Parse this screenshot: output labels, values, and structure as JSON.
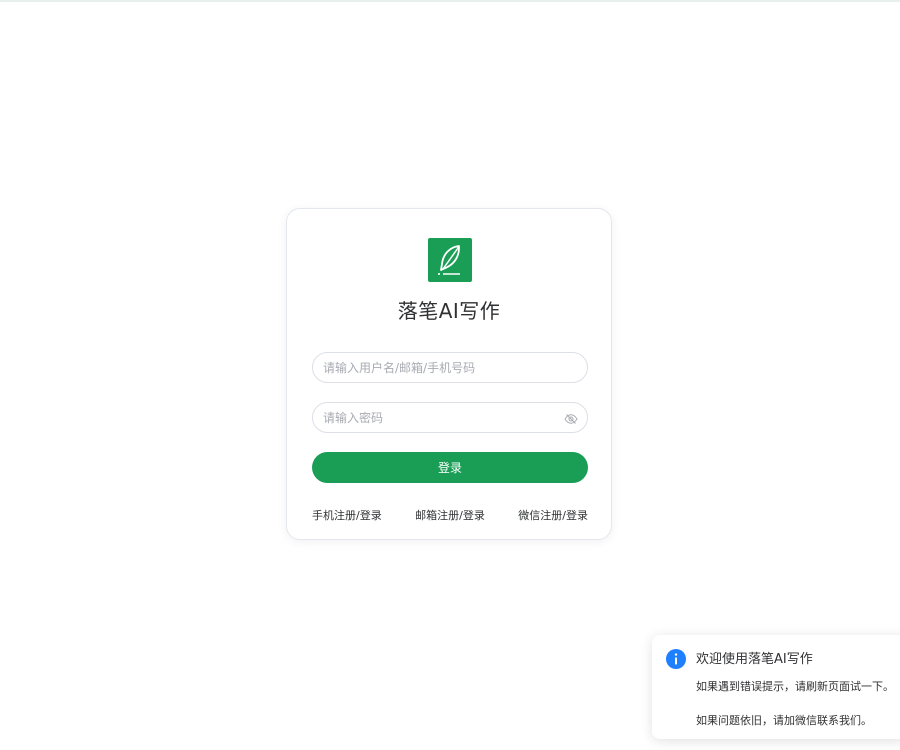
{
  "app": {
    "title": "落笔AI写作",
    "brand_color": "#1a9d55"
  },
  "login_form": {
    "username_placeholder": "请输入用户名/邮箱/手机号码",
    "password_placeholder": "请输入密码",
    "password_toggle_icon": "eye-icon",
    "submit_label": "登录"
  },
  "register_links": [
    {
      "label": "手机注册/登录"
    },
    {
      "label": "邮箱注册/登录"
    },
    {
      "label": "微信注册/登录"
    }
  ],
  "notification": {
    "icon": "info-icon",
    "icon_color": "#1e80ff",
    "title": "欢迎使用落笔AI写作",
    "lines": [
      "如果遇到错误提示，请刷新页面试一下。",
      "如果问题依旧，请加微信联系我们。"
    ]
  }
}
